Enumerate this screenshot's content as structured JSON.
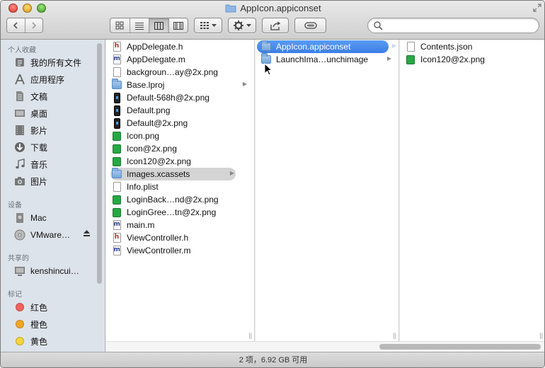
{
  "window": {
    "title": "AppIcon.appiconset"
  },
  "toolbar": {
    "back_icon": "back-arrow-icon",
    "forward_icon": "forward-arrow-icon",
    "view_modes": [
      "icon-view",
      "list-view",
      "column-view",
      "coverflow-view"
    ],
    "active_view": "column-view",
    "search_placeholder": ""
  },
  "sidebar": {
    "favorites_header": "个人收藏",
    "favorites": [
      {
        "label": "我的所有文件",
        "icon": "all-files-icon"
      },
      {
        "label": "应用程序",
        "icon": "applications-icon"
      },
      {
        "label": "文稿",
        "icon": "documents-icon"
      },
      {
        "label": "桌面",
        "icon": "desktop-icon"
      },
      {
        "label": "影片",
        "icon": "movies-icon"
      },
      {
        "label": "下载",
        "icon": "downloads-icon"
      },
      {
        "label": "音乐",
        "icon": "music-icon"
      },
      {
        "label": "图片",
        "icon": "pictures-icon"
      }
    ],
    "devices_header": "设备",
    "devices": [
      {
        "label": "Mac",
        "icon": "hard-drive-icon"
      },
      {
        "label": "VMware…",
        "icon": "disc-icon",
        "eject": true
      }
    ],
    "shared_header": "共享的",
    "shared": [
      {
        "label": "kenshincui…",
        "icon": "computer-icon"
      }
    ],
    "tags_header": "标记",
    "tags": [
      {
        "label": "红色",
        "color": "#f0625b"
      },
      {
        "label": "橙色",
        "color": "#f6a623"
      },
      {
        "label": "黄色",
        "color": "#f5d43a"
      }
    ]
  },
  "columns": {
    "col1": [
      {
        "name": "AppDelegate.h",
        "icon": "h-file"
      },
      {
        "name": "AppDelegate.m",
        "icon": "m-file"
      },
      {
        "name": "backgroun…ay@2x.png",
        "icon": "blank-file"
      },
      {
        "name": "Base.lproj",
        "icon": "folder",
        "arrow": true
      },
      {
        "name": "Default-568h@2x.png",
        "icon": "dark-image"
      },
      {
        "name": "Default.png",
        "icon": "dark-image"
      },
      {
        "name": "Default@2x.png",
        "icon": "dark-image"
      },
      {
        "name": "Icon.png",
        "icon": "green-image"
      },
      {
        "name": "Icon@2x.png",
        "icon": "green-image"
      },
      {
        "name": "Icon120@2x.png",
        "icon": "green-image"
      },
      {
        "name": "Images.xcassets",
        "icon": "folder",
        "arrow": true,
        "selected": "gray"
      },
      {
        "name": "Info.plist",
        "icon": "blank-file"
      },
      {
        "name": "LoginBack…nd@2x.png",
        "icon": "green-image"
      },
      {
        "name": "LoginGree…tn@2x.png",
        "icon": "green-image"
      },
      {
        "name": "main.m",
        "icon": "m-file"
      },
      {
        "name": "ViewController.h",
        "icon": "h-file"
      },
      {
        "name": "ViewController.m",
        "icon": "m-file"
      }
    ],
    "col2": [
      {
        "name": "AppIcon.appiconset",
        "icon": "folder",
        "arrow": true,
        "selected": "blue"
      },
      {
        "name": "LaunchIma…unchimage",
        "icon": "folder",
        "arrow": true
      }
    ],
    "col3": [
      {
        "name": "Contents.json",
        "icon": "blank-file"
      },
      {
        "name": "Icon120@2x.png",
        "icon": "green-image"
      }
    ]
  },
  "status": {
    "text": "2 项，6.92 GB 可用"
  }
}
